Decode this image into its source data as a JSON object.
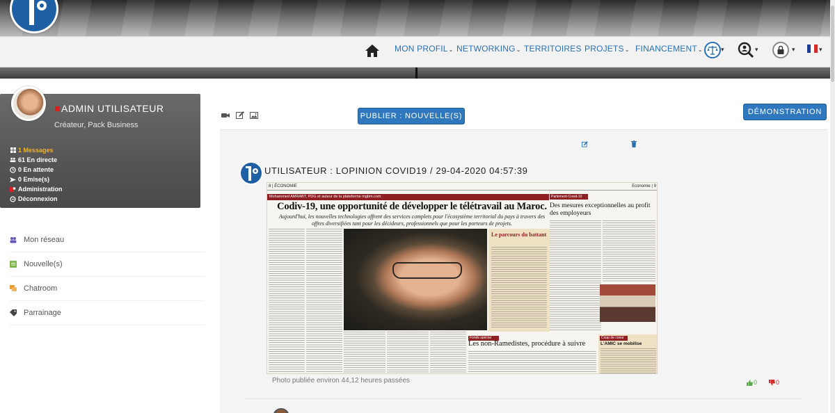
{
  "nav": {
    "items": [
      {
        "label": "MON PROFIL",
        "dropdown": true
      },
      {
        "label": "NETWORKING",
        "dropdown": true
      },
      {
        "label": "TERRITOIRES",
        "dropdown": false
      },
      {
        "label": "PROJETS",
        "dropdown": true
      },
      {
        "label": "FINANCEMENT",
        "dropdown": true
      }
    ],
    "icons": [
      "home-icon",
      "scales-icon",
      "search-user-icon",
      "lock-icon",
      "french-flag-icon"
    ],
    "accent": "#2a6fb0"
  },
  "profile": {
    "name": "ADMIN UTILISATEUR",
    "role": "Créateur, Pack Business",
    "stats": [
      {
        "label": "1 Messages",
        "icon": "messages-icon",
        "color": "#f2b233"
      },
      {
        "label": "61 En directe",
        "icon": "users-icon",
        "color": "#ffffff"
      },
      {
        "label": "0 En attente",
        "icon": "clock-icon",
        "color": "#ffffff"
      },
      {
        "label": "0 Emise(s)",
        "icon": "send-icon",
        "color": "#ffffff"
      },
      {
        "label": "Administration",
        "icon": "admin-icon",
        "color": "#ffffff"
      },
      {
        "label": "Déconnexion",
        "icon": "logout-icon",
        "color": "#ffffff"
      }
    ]
  },
  "sidebar": {
    "items": [
      {
        "label": "Mon réseau",
        "icon": "network-icon",
        "color": "#6a56b8"
      },
      {
        "label": "Nouvelle(s)",
        "icon": "news-icon",
        "color": "#7cb84a"
      },
      {
        "label": "Chatroom",
        "icon": "chat-icon",
        "color": "#e69a3a"
      },
      {
        "label": "Parrainage",
        "icon": "tag-icon",
        "color": "#444444"
      }
    ]
  },
  "toolbar": {
    "publish_label": "PUBLIER : NOUVELLE(S)",
    "demo_label": "DÉMONSTRATION",
    "icons": [
      "video-icon",
      "edit-icon",
      "image-icon"
    ]
  },
  "post": {
    "title": "UTILISATEUR : LOPINION COVID19 / 29-04-2020 04:57:39",
    "caption": "Photo publiée environ 44,12 heures passées",
    "likes": "0",
    "dislikes": "0"
  },
  "newspaper": {
    "page_left": "8 | ÉCONOMIE",
    "page_right": "Economie | 9",
    "kicker": "Mohammed AMRABT, PDG et auteur de la plateforme mgbm.com",
    "headline": "Codiv-19, une opportunité de développer le télétravail au Maroc.",
    "deck": "Aujourd'hui, les nouvelles technologies offrent des services complets pour l'écosystème territorial du pays à travers des offres diversifiées tant pour les décideurs, professionnels que pour les porteurs de projets.",
    "sidebox_title": "Le parcours du battant",
    "right_kicker": "Parlement-Covid-19",
    "right_headline": "Des mesures exceptionnelles au profit des employeurs",
    "bottom_kicker": "Fonds spécial",
    "bottom_headline": "Les non-Ramedistes, procédure à suivre",
    "box2_kicker": "Coup de coeur",
    "box2_title": "L'AMIC se mobilise"
  }
}
